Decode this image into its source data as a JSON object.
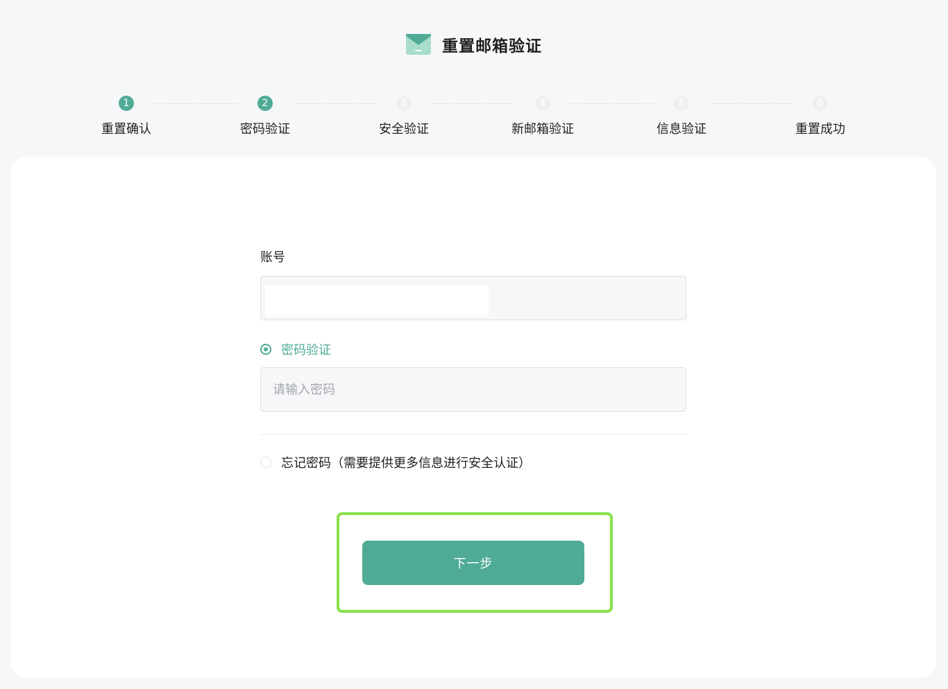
{
  "header": {
    "title": "重置邮箱验证",
    "icon": "mail-icon",
    "icon_color": "#a8dccb"
  },
  "steps": [
    {
      "number": "1",
      "label": "重置确认",
      "status": "done"
    },
    {
      "number": "2",
      "label": "密码验证",
      "status": "current"
    },
    {
      "number": "3",
      "label": "安全验证",
      "status": "pending"
    },
    {
      "number": "4",
      "label": "新邮箱验证",
      "status": "pending"
    },
    {
      "number": "5",
      "label": "信息验证",
      "status": "pending"
    },
    {
      "number": "6",
      "label": "重置成功",
      "status": "pending"
    }
  ],
  "form": {
    "account_label": "账号",
    "account_value": "",
    "options": [
      {
        "label": "密码验证",
        "selected": true
      },
      {
        "label": "忘记密码（需要提供更多信息进行安全认证）",
        "selected": false
      }
    ],
    "password_placeholder": "请输入密码",
    "password_value": "",
    "next_label": "下一步"
  },
  "colors": {
    "accent": "#50ab96",
    "highlight": "#86e049",
    "background": "#f6f7f9"
  }
}
